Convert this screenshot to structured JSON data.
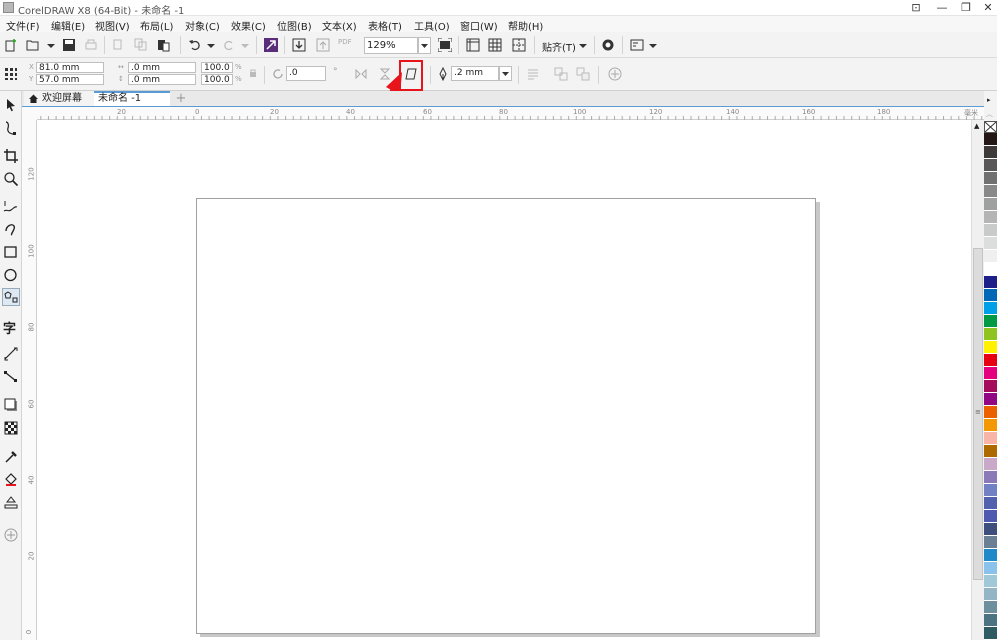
{
  "window": {
    "title": "CorelDRAW X8 (64-Bit) - 未命名 -1"
  },
  "menu": [
    "文件(F)",
    "编辑(E)",
    "视图(V)",
    "布局(L)",
    "对象(C)",
    "效果(C)",
    "位图(B)",
    "文本(X)",
    "表格(T)",
    "工具(O)",
    "窗口(W)",
    "帮助(H)"
  ],
  "standard_toolbar": {
    "zoom": "129%",
    "snap_label": "贴齐(T)",
    "pdf_label": "PDF"
  },
  "property_bar": {
    "x": "81.0 mm",
    "y": "57.0 mm",
    "width": ".0 mm",
    "height": ".0 mm",
    "scale_w": "100.0",
    "scale_h": "100.0",
    "percent": "%",
    "angle": ".0",
    "outline_width": ".2 mm"
  },
  "tabs": {
    "welcome": "欢迎屏幕",
    "document": "未命名 -1"
  },
  "ruler": {
    "h_labels": [
      "20",
      "0",
      "20",
      "40",
      "60",
      "80",
      "100",
      "120",
      "140",
      "160",
      "180"
    ],
    "unit": "毫米",
    "v_labels": [
      "120",
      "100",
      "80",
      "60",
      "40",
      "20",
      "0"
    ]
  },
  "palette_colors": [
    "#231815",
    "#3e3a39",
    "#595757",
    "#727171",
    "#898989",
    "#9fa0a0",
    "#b5b5b6",
    "#c9caca",
    "#dcdddd",
    "#efefef",
    "#ffffff",
    "#1d2088",
    "#0068b7",
    "#00a0e9",
    "#009944",
    "#8fc31f",
    "#fff100",
    "#e60012",
    "#e4007f",
    "#a40b5d",
    "#920783",
    "#eb6100",
    "#f39800",
    "#f8b4a6",
    "#ac6a00",
    "#c9a8c9",
    "#8c7ab8",
    "#7181c4",
    "#5261ad",
    "#4d5aaf",
    "#3e4f7e",
    "#6b7f95",
    "#1f8ac7",
    "#89c3eb",
    "#a0c8d8",
    "#93b5c6",
    "#6d8f9e",
    "#4c7381",
    "#2f5c63"
  ]
}
